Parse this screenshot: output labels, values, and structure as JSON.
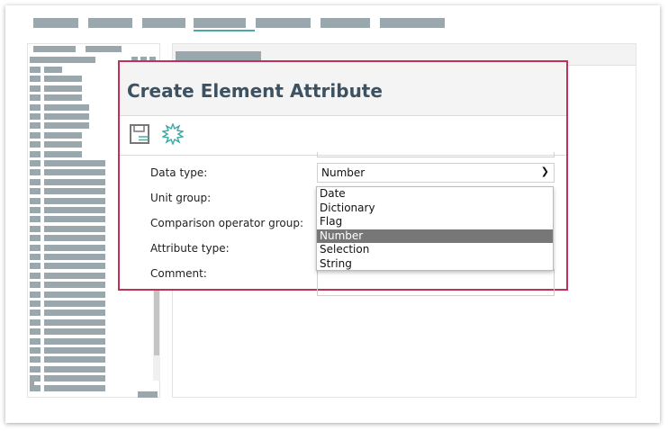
{
  "dialog": {
    "title": "Create Element Attribute",
    "toolbar": {
      "save_icon": "save-icon",
      "new_icon": "new-starburst-icon"
    },
    "fields": {
      "data_type": "Data type:",
      "unit_group": "Unit group:",
      "comparison_operator_group": "Comparison operator group:",
      "attribute_type": "Attribute type:",
      "comment": "Comment:"
    },
    "data_type_value": "Number",
    "data_type_options": [
      "Date",
      "Dictionary",
      "Flag",
      "Number",
      "Selection",
      "String"
    ]
  },
  "colors": {
    "dialog_border": "#c0315a",
    "title": "#3c5263",
    "accent": "#4aa9a4"
  }
}
